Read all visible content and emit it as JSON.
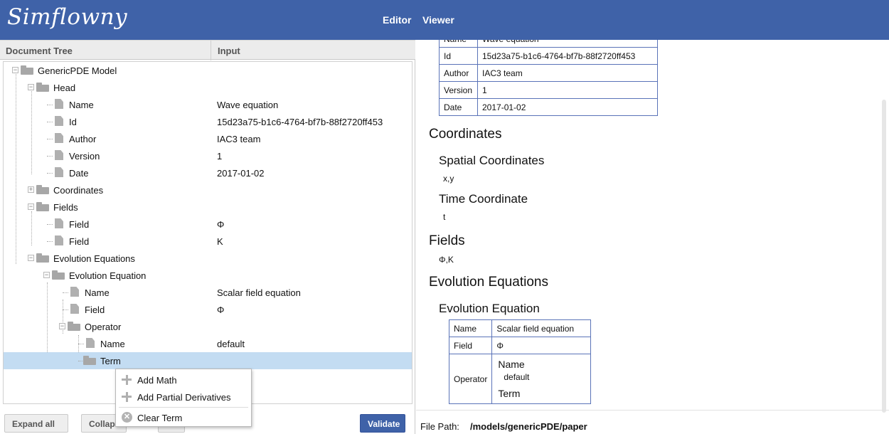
{
  "app": {
    "logo": "Simflowny"
  },
  "nav": {
    "editor": "Editor",
    "viewer": "Viewer"
  },
  "tree": {
    "col_document": "Document Tree",
    "col_input": "Input",
    "nodes": [
      {
        "label": "GenericPDE Model",
        "value": "",
        "type": "folder"
      },
      {
        "label": "Head",
        "value": "",
        "type": "folder"
      },
      {
        "label": "Name",
        "value": "Wave equation",
        "type": "doc"
      },
      {
        "label": "Id",
        "value": "15d23a75-b1c6-4764-bf7b-88f2720ff453",
        "type": "doc"
      },
      {
        "label": "Author",
        "value": "IAC3 team",
        "type": "doc"
      },
      {
        "label": "Version",
        "value": "1",
        "type": "doc"
      },
      {
        "label": "Date",
        "value": "2017-01-02",
        "type": "doc"
      },
      {
        "label": "Coordinates",
        "value": "",
        "type": "folder"
      },
      {
        "label": "Fields",
        "value": "",
        "type": "folder"
      },
      {
        "label": "Field",
        "value": "Φ",
        "type": "doc"
      },
      {
        "label": "Field",
        "value": "K",
        "type": "doc"
      },
      {
        "label": "Evolution Equations",
        "value": "",
        "type": "folder"
      },
      {
        "label": "Evolution Equation",
        "value": "",
        "type": "folder"
      },
      {
        "label": "Name",
        "value": "Scalar field equation",
        "type": "doc"
      },
      {
        "label": "Field",
        "value": "Φ",
        "type": "doc"
      },
      {
        "label": "Operator",
        "value": "",
        "type": "folder"
      },
      {
        "label": "Name",
        "value": "default",
        "type": "doc"
      },
      {
        "label": "Term",
        "value": "",
        "type": "folder"
      }
    ]
  },
  "buttons": {
    "expand_all": "Expand all",
    "collapse_all": "Collapse",
    "validate": "Validate"
  },
  "context_menu": {
    "add_math": "Add Math",
    "add_partial": "Add Partial Derivatives",
    "clear_term": "Clear Term"
  },
  "viewer": {
    "head_table": [
      {
        "k": "Name",
        "v": "Wave equation"
      },
      {
        "k": "Id",
        "v": "15d23a75-b1c6-4764-bf7b-88f2720ff453"
      },
      {
        "k": "Author",
        "v": "IAC3 team"
      },
      {
        "k": "Version",
        "v": "1"
      },
      {
        "k": "Date",
        "v": "2017-01-02"
      }
    ],
    "coordinates": "Coordinates",
    "spatial_coordinates": "Spatial Coordinates",
    "spatial_value": "x,y",
    "time_coordinate": "Time Coordinate",
    "time_value": "t",
    "fields": "Fields",
    "fields_value": "Φ,K",
    "evolution_equations": "Evolution Equations",
    "evolution_equation": "Evolution Equation",
    "eq_table": {
      "name_k": "Name",
      "name_v": "Scalar field equation",
      "field_k": "Field",
      "field_v": "Φ",
      "operator_k": "Operator",
      "op_name": "Name",
      "op_default": "default",
      "op_term": "Term"
    }
  },
  "file_path": {
    "label": "File Path:",
    "value": "/models/genericPDE/paper"
  }
}
